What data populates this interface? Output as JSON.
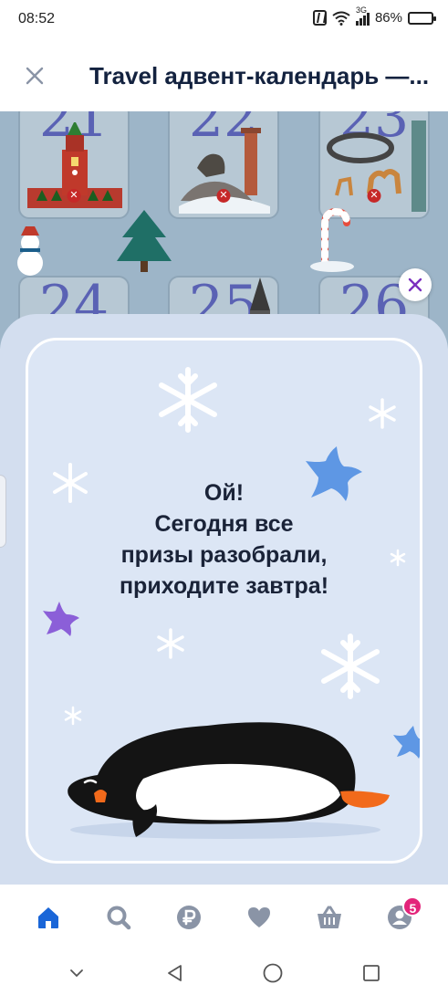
{
  "status_bar": {
    "time": "08:52",
    "network": "3G",
    "battery": "86%",
    "battery_level": 0.86
  },
  "header": {
    "title": "Travel адвент-календарь —...",
    "close_icon": "close-icon"
  },
  "calendar": {
    "days": [
      "21",
      "22",
      "23",
      "24",
      "25",
      "26"
    ]
  },
  "dialog": {
    "close_icon": "close-icon",
    "message_lines": [
      "Ой!",
      "Сегодня все",
      "призы разобрали,",
      "приходите завтра!"
    ]
  },
  "bottom_nav": {
    "items": [
      {
        "icon": "home-icon",
        "active": true
      },
      {
        "icon": "search-icon",
        "active": false
      },
      {
        "icon": "ruble-icon",
        "active": false
      },
      {
        "icon": "heart-icon",
        "active": false
      },
      {
        "icon": "basket-icon",
        "active": false
      },
      {
        "icon": "profile-icon",
        "active": false,
        "badge": "5"
      }
    ]
  },
  "system_nav": {
    "items": [
      "collapse-icon",
      "back-icon",
      "home-circle-icon",
      "recents-icon"
    ]
  },
  "colors": {
    "accent": "#1a66d8",
    "nav_inactive": "#8a94a6",
    "sheet": "#d3deef",
    "title": "#13223f",
    "badge": "#e3247a",
    "dialog_close": "#7b2fbf"
  }
}
